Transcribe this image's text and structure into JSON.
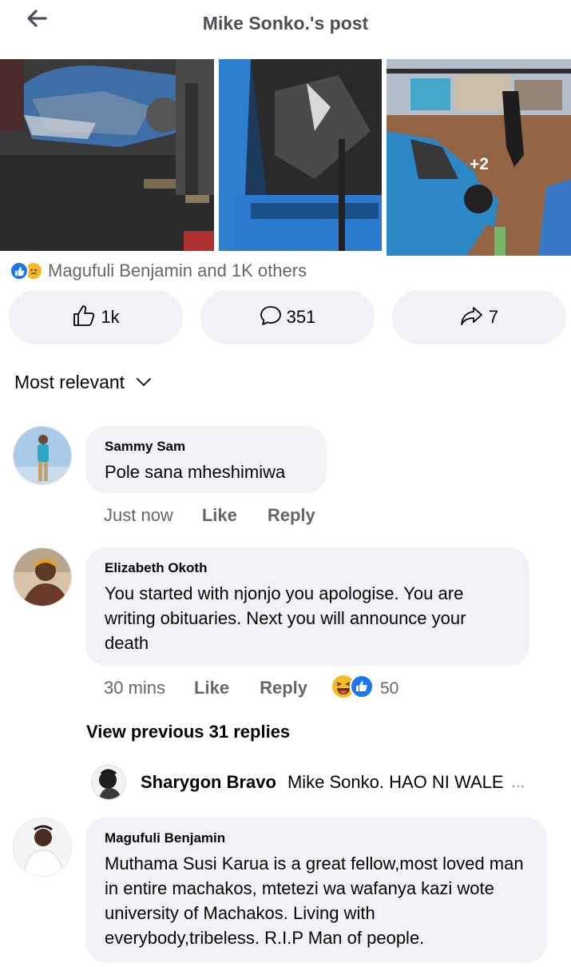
{
  "header": {
    "title": "Mike Sonko.'s post",
    "back_icon": "arrow-left-icon"
  },
  "photos": {
    "more_count": "+2"
  },
  "reactions": {
    "summary": "Magufuli Benjamin and 1K others",
    "icons": [
      "like-reaction-icon",
      "sad-reaction-icon"
    ],
    "colors": {
      "like": "#1877f2",
      "sad": "#f7b928"
    }
  },
  "actions": {
    "like_count": "1k",
    "comment_count": "351",
    "share_count": "7"
  },
  "sort": {
    "label": "Most relevant"
  },
  "comments": [
    {
      "author": "Sammy Sam",
      "text": "Pole sana mheshimiwa",
      "time": "Just now",
      "like_label": "Like",
      "reply_label": "Reply"
    },
    {
      "author": "Elizabeth Okoth",
      "text": "You started  with njonjo you apologise. You are writing  obituaries. Next you will announce  your death",
      "time": "30 mins",
      "like_label": "Like",
      "reply_label": "Reply",
      "reaction_count": "50"
    },
    {
      "author": "Magufuli Benjamin",
      "text": "Muthama Susi Karua is a great fellow,most loved man in entire machakos, mtetezi wa wafanya kazi wote university of Machakos. Living with everybody,tribeless.  R.I.P Man of people."
    }
  ],
  "replies": {
    "view_previous": "View previous 31 replies",
    "latest": {
      "author": "Sharygon Bravo",
      "text": "Mike Sonko. HAO NI WALE",
      "ellipsis": "..."
    }
  }
}
